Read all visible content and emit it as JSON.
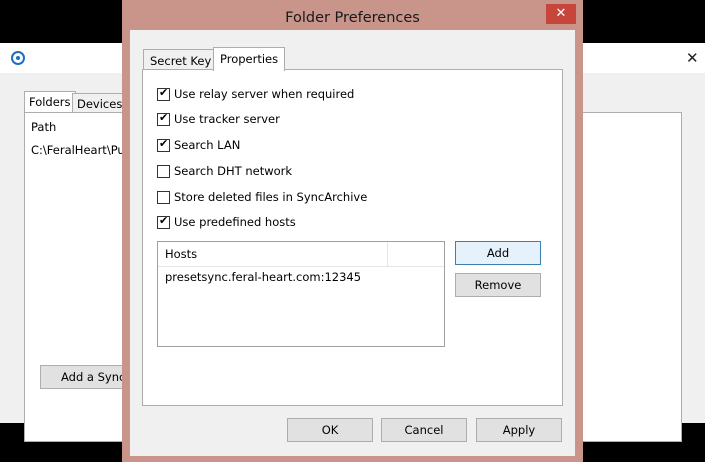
{
  "background_window": {
    "close_glyph": "✕",
    "tabs": [
      "Folders",
      "Devices"
    ],
    "column_header": "Path",
    "row_value": "C:\\FeralHeart\\Pul",
    "add_button_label": "Add a Sync"
  },
  "dialog": {
    "title": "Folder Preferences",
    "close_glyph": "✕",
    "tabs": [
      {
        "label": "Secret Key",
        "active": false
      },
      {
        "label": "Properties",
        "active": true
      }
    ],
    "options": [
      {
        "label": "Use relay server when required",
        "checked": true
      },
      {
        "label": "Use tracker server",
        "checked": true
      },
      {
        "label": "Search LAN",
        "checked": true
      },
      {
        "label": "Search DHT network",
        "checked": false
      },
      {
        "label": "Store deleted files in SyncArchive",
        "checked": false
      },
      {
        "label": "Use predefined hosts",
        "checked": true
      }
    ],
    "hosts": {
      "header": "Hosts",
      "rows": [
        "presetsync.feral-heart.com:12345"
      ]
    },
    "add_label": "Add",
    "remove_label": "Remove",
    "ok_label": "OK",
    "cancel_label": "Cancel",
    "apply_label": "Apply"
  }
}
